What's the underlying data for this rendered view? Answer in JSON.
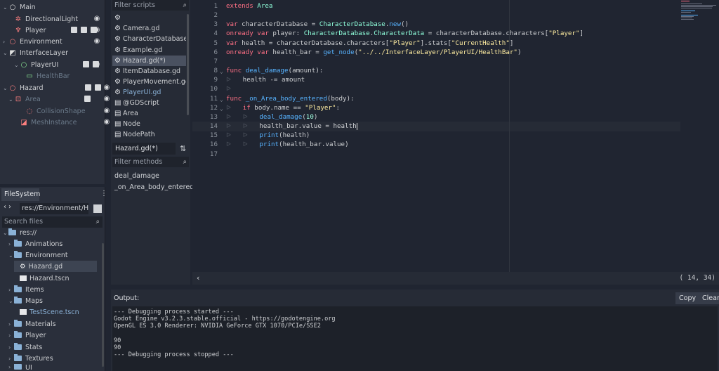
{
  "scene_tree": {
    "nodes": [
      {
        "label": "Main",
        "icon": "node-circle-icon",
        "color": "#e0e0e0"
      },
      {
        "label": "DirectionalLight",
        "icon": "light-icon",
        "color": "#fc7f7f"
      },
      {
        "label": "Player",
        "icon": "skeleton-icon",
        "color": "#fc7f7f"
      },
      {
        "label": "Environment",
        "icon": "node-circle-icon",
        "color": "#fc7f7f"
      },
      {
        "label": "InterfaceLayer",
        "icon": "canvas-layer-icon",
        "color": "#e0e0e0"
      },
      {
        "label": "PlayerUI",
        "icon": "control-circle-icon",
        "color": "#8eef97"
      },
      {
        "label": "HealthBar",
        "icon": "progress-bar-icon",
        "color": "#8eef97"
      },
      {
        "label": "Hazard",
        "icon": "node-circle-icon",
        "color": "#fc7f7f"
      },
      {
        "label": "Area",
        "icon": "area-icon",
        "color": "#fc7f7f"
      },
      {
        "label": "CollisionShape",
        "icon": "collision-shape-icon",
        "color": "#fc7f7f"
      },
      {
        "label": "MeshInstance",
        "icon": "mesh-icon",
        "color": "#fc7f7f"
      }
    ]
  },
  "filesystem": {
    "tab": "FileSystem",
    "path": "res://Environment/Ha",
    "search_placeholder": "Search files",
    "items": [
      {
        "label": "res://"
      },
      {
        "label": "Animations"
      },
      {
        "label": "Environment"
      },
      {
        "label": "Hazard.gd"
      },
      {
        "label": "Hazard.tscn"
      },
      {
        "label": "Items"
      },
      {
        "label": "Maps"
      },
      {
        "label": "TestScene.tscn"
      },
      {
        "label": "Materials"
      },
      {
        "label": "Player"
      },
      {
        "label": "Stats"
      },
      {
        "label": "Textures"
      },
      {
        "label": "UI"
      }
    ]
  },
  "scripts": {
    "filter_placeholder": "Filter scripts",
    "items": [
      {
        "label": ""
      },
      {
        "label": "Camera.gd"
      },
      {
        "label": "CharacterDatabase.gd"
      },
      {
        "label": "Example.gd"
      },
      {
        "label": "Hazard.gd(*)"
      },
      {
        "label": "ItemDatabase.gd"
      },
      {
        "label": "PlayerMovement.gd"
      },
      {
        "label": "PlayerUI.gd"
      },
      {
        "label": "@GDScript"
      },
      {
        "label": "Area"
      },
      {
        "label": "Node"
      },
      {
        "label": "NodePath"
      }
    ],
    "current": "Hazard.gd(*)",
    "methods_placeholder": "Filter methods",
    "methods": [
      "deal_damage",
      "_on_Area_body_entered"
    ]
  },
  "editor": {
    "line_numbers": [
      "1",
      "2",
      "3",
      "4",
      "5",
      "6",
      "7",
      "8",
      "9",
      "10",
      "11",
      "12",
      "13",
      "14",
      "15",
      "16",
      "17"
    ],
    "cursor_position": "( 14, 34)"
  },
  "output": {
    "title": "Output:",
    "copy_label": "Copy",
    "clear_label": "Clear",
    "log": "--- Debugging process started ---\nGodot Engine v3.2.3.stable.official - https://godotengine.org\nOpenGL ES 3.0 Renderer: NVIDIA GeForce GTX 1070/PCIe/SSE2\n\n90\n90\n--- Debugging process stopped ---"
  },
  "colors": {
    "keyword": "#ff7085",
    "type": "#8fffdb",
    "function": "#57b3ff",
    "string": "#ffeda1"
  }
}
